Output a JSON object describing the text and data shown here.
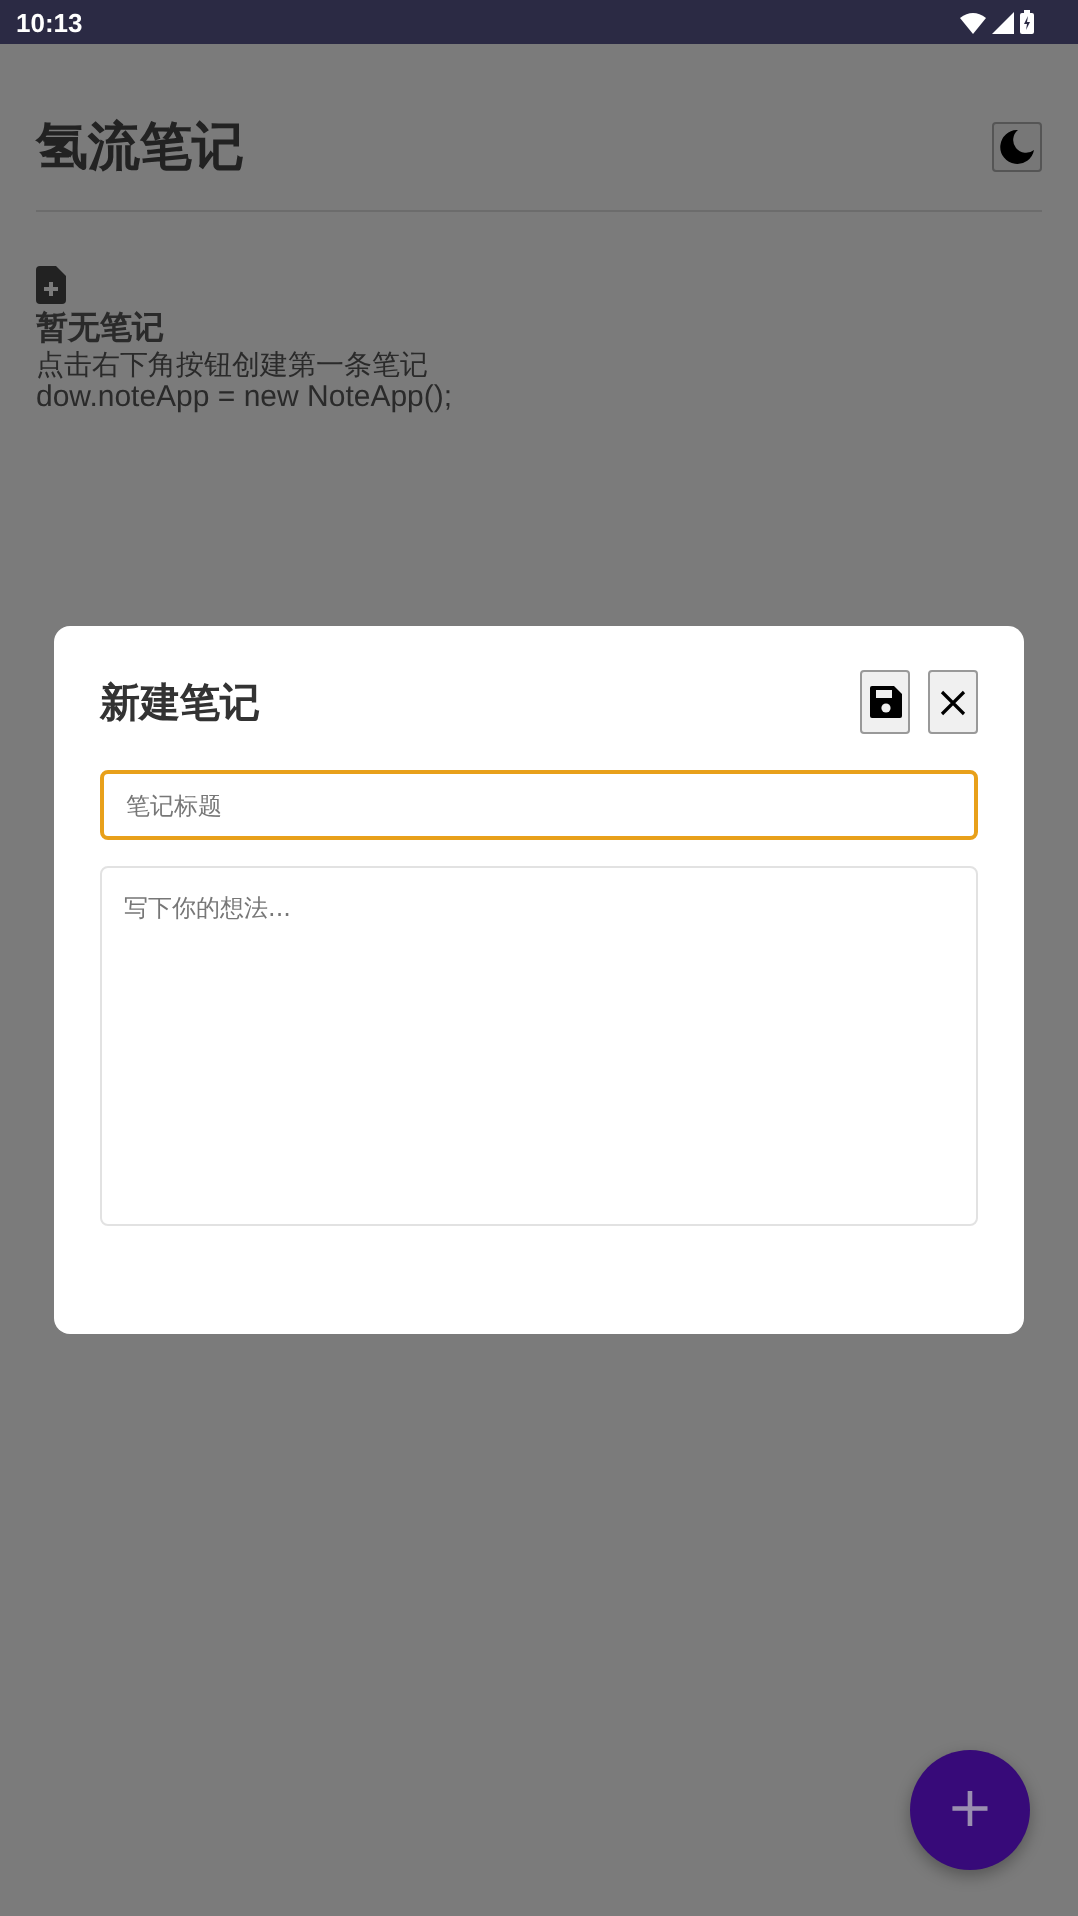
{
  "status_bar": {
    "time": "10:13"
  },
  "header": {
    "title": "氢流笔记"
  },
  "empty_state": {
    "title": "暂无笔记",
    "message": "点击右下角按钮创建第一条笔记",
    "code_line": "dow.noteApp = new NoteApp();"
  },
  "dialog": {
    "title": "新建笔记",
    "title_field": {
      "placeholder": "笔记标题",
      "focused": true
    },
    "content_field": {
      "placeholder": "写下你的想法..."
    }
  },
  "fab": {
    "label": "+"
  }
}
